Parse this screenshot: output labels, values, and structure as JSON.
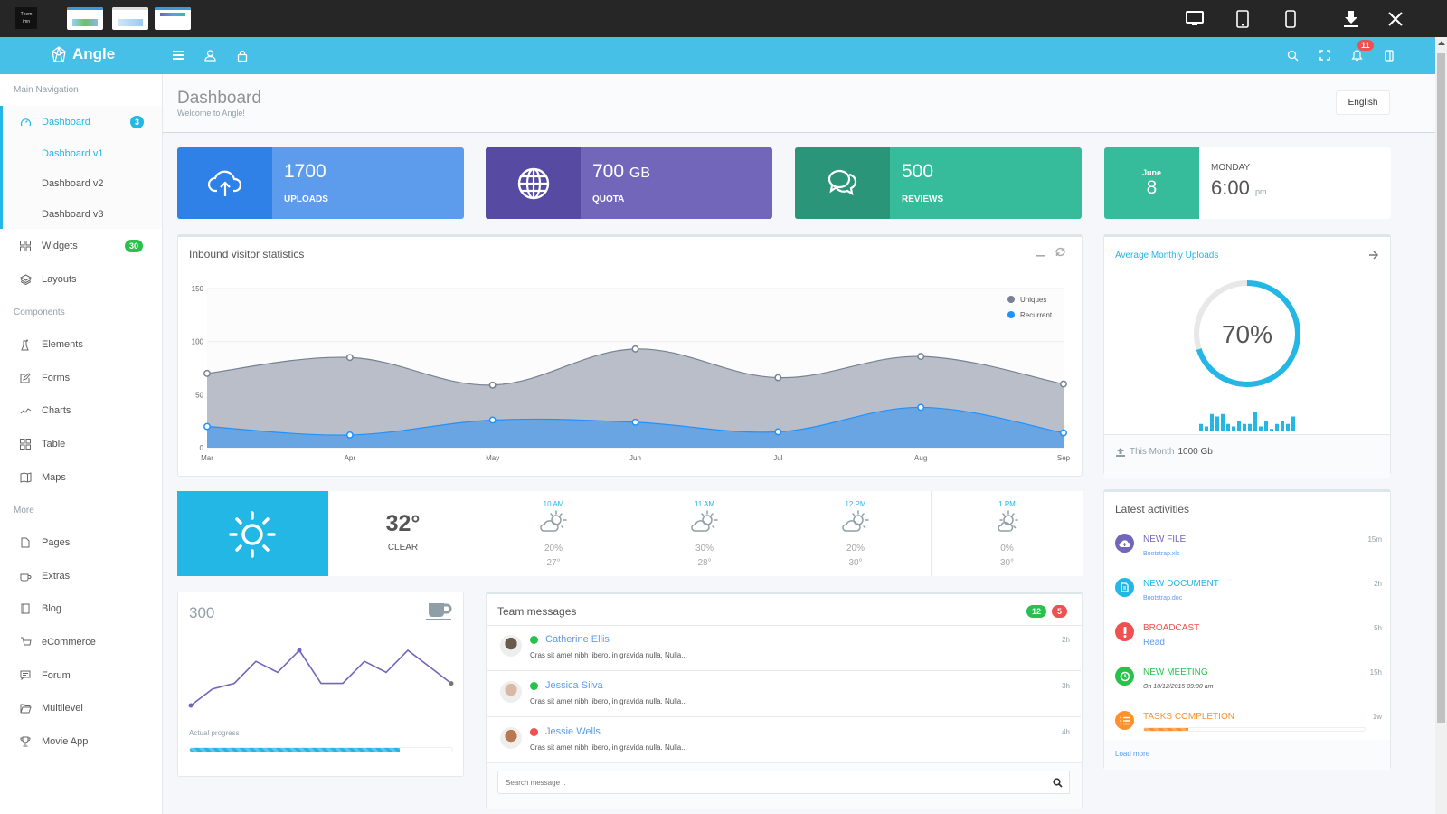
{
  "browser": {
    "theme_logo_text": "Them\nimn",
    "thumbnails": [
      "dashboard-preview-1",
      "dashboard-preview-2",
      "dashboard-preview-3"
    ],
    "device_icons": [
      "desktop-icon",
      "tablet-icon",
      "mobile-icon",
      "download-icon",
      "close-icon"
    ]
  },
  "navbar": {
    "brand": "Angle",
    "left_icons": [
      "menu-icon",
      "user-icon",
      "lock-icon"
    ],
    "right_icons": [
      "search-icon",
      "fullscreen-icon",
      "bell-icon",
      "sidebar-toggle-icon"
    ],
    "notifications_count": "11"
  },
  "sidebar": {
    "sections": [
      {
        "heading": "Main Navigation"
      },
      {
        "heading": "Components"
      },
      {
        "heading": "More"
      }
    ],
    "items": [
      {
        "label": "Dashboard",
        "icon": "speedometer-icon",
        "badge": "3",
        "badge_color": "#23b7e5",
        "active": true
      },
      {
        "label": "Dashboard v1",
        "sub": true,
        "active": true
      },
      {
        "label": "Dashboard v2",
        "sub": true
      },
      {
        "label": "Dashboard v3",
        "sub": true
      },
      {
        "label": "Widgets",
        "icon": "grid-icon",
        "badge": "30",
        "badge_color": "#27c24c"
      },
      {
        "label": "Layouts",
        "icon": "layers-icon"
      },
      {
        "label": "Elements",
        "icon": "chemistry-icon"
      },
      {
        "label": "Forms",
        "icon": "note-icon"
      },
      {
        "label": "Charts",
        "icon": "graph-icon"
      },
      {
        "label": "Table",
        "icon": "table-grid-icon"
      },
      {
        "label": "Maps",
        "icon": "map-icon"
      },
      {
        "label": "Pages",
        "icon": "document-icon"
      },
      {
        "label": "Extras",
        "icon": "cup-icon"
      },
      {
        "label": "Blog",
        "icon": "notebook-icon"
      },
      {
        "label": "eCommerce",
        "icon": "basket-icon"
      },
      {
        "label": "Forum",
        "icon": "speech-icon"
      },
      {
        "label": "Multilevel",
        "icon": "folder-icon"
      },
      {
        "label": "Movie App",
        "icon": "trophy-icon"
      }
    ]
  },
  "header": {
    "title": "Dashboard",
    "subtitle": "Welcome to Angle!",
    "language": "English"
  },
  "stats": [
    {
      "value": "1700",
      "unit": "",
      "label": "UPLOADS",
      "icon": "cloud-upload-icon",
      "color_dark": "#2f80e7",
      "color_light": "#5d9cec"
    },
    {
      "value": "700",
      "unit": "GB",
      "label": "QUOTA",
      "icon": "globe-icon",
      "color_dark": "#564aa3",
      "color_light": "#7266ba"
    },
    {
      "value": "500",
      "unit": "",
      "label": "REVIEWS",
      "icon": "bubbles-icon",
      "color_dark": "#2b957a",
      "color_light": "#37bc9b"
    }
  ],
  "date_widget": {
    "month": "June",
    "day": "8",
    "weekday": "MONDAY",
    "time": "6:00",
    "ampm": "pm"
  },
  "visitor_chart": {
    "title": "Inbound visitor statistics",
    "controls": [
      "collapse-icon",
      "refresh-icon"
    ]
  },
  "chart_data": {
    "type": "area",
    "title": "Inbound visitor statistics",
    "categories": [
      "Mar",
      "Apr",
      "May",
      "Jun",
      "Jul",
      "Aug",
      "Sep"
    ],
    "ylim": [
      0,
      150
    ],
    "yticks": [
      0,
      50,
      100,
      150
    ],
    "grid": true,
    "legend": "top-right",
    "series": [
      {
        "name": "Uniques",
        "color": "#768294",
        "values": [
          70,
          85,
          59,
          93,
          66,
          86,
          60
        ]
      },
      {
        "name": "Recurrent",
        "color": "#1f92fe",
        "values": [
          20,
          12,
          26,
          24,
          15,
          38,
          14
        ]
      }
    ]
  },
  "monthly_uploads": {
    "title": "Average Monthly Uploads",
    "percent": 70,
    "percent_label": "70%",
    "bars": [
      3,
      2,
      7,
      6,
      7,
      3,
      2,
      4,
      3,
      3,
      8,
      2,
      4,
      1,
      3,
      4,
      3,
      6
    ],
    "footer_label": "This Month",
    "footer_value": "1000 Gb"
  },
  "weather": {
    "current_temp": "32°",
    "current_condition": "CLEAR",
    "hours": [
      {
        "time": "10 AM",
        "icon": "cloudy-day-icon",
        "precip": "20%",
        "temp": "27°"
      },
      {
        "time": "11 AM",
        "icon": "cloudy-day-icon",
        "precip": "30%",
        "temp": "28°"
      },
      {
        "time": "12 PM",
        "icon": "cloudy-day-icon",
        "precip": "20%",
        "temp": "30°"
      },
      {
        "time": "1 PM",
        "icon": "partly-sunny-icon",
        "precip": "0%",
        "temp": "30°"
      }
    ]
  },
  "progress_widget": {
    "value": "300",
    "sparkline": [
      1,
      4,
      5,
      9,
      7,
      11,
      5,
      5,
      9,
      7,
      11,
      8,
      5
    ],
    "label": "Actual progress",
    "progress": 0.8
  },
  "team_messages": {
    "title": "Team messages",
    "badge_green": "12",
    "badge_red": "5",
    "messages": [
      {
        "name": "Catherine Ellis",
        "status": "online",
        "status_color": "#27c24c",
        "text": "Cras sit amet nibh libero, in gravida nulla. Nulla...",
        "time": "2h"
      },
      {
        "name": "Jessica Silva",
        "status": "online",
        "status_color": "#27c24c",
        "text": "Cras sit amet nibh libero, in gravida nulla. Nulla...",
        "time": "3h"
      },
      {
        "name": "Jessie Wells",
        "status": "busy",
        "status_color": "#f05050",
        "text": "Cras sit amet nibh libero, in gravida nulla. Nulla...",
        "time": "4h"
      }
    ],
    "search_placeholder": "Search message .."
  },
  "activities": {
    "title": "Latest activities",
    "items": [
      {
        "title": "NEW FILE",
        "sub": "Bootstrap.xls",
        "time": "15m",
        "color": "#7266ba",
        "icon": "cloud-upload-icon"
      },
      {
        "title": "NEW DOCUMENT",
        "sub": "Bootstrap.doc",
        "time": "2h",
        "color": "#23b7e5",
        "icon": "document-icon"
      },
      {
        "title": "BROADCAST",
        "sub": "Read",
        "time": "5h",
        "color": "#f05050",
        "icon": "alert-icon"
      },
      {
        "title": "NEW MEETING",
        "sub": "On 10/12/2015 09:00 am",
        "time": "15h",
        "color": "#27c24c",
        "icon": "clock-icon"
      },
      {
        "title": "TASKS COMPLETION",
        "sub": "",
        "time": "1w",
        "color": "#ff902b",
        "icon": "tasks-icon",
        "progress": 0.2
      }
    ],
    "load_more": "Load more"
  }
}
